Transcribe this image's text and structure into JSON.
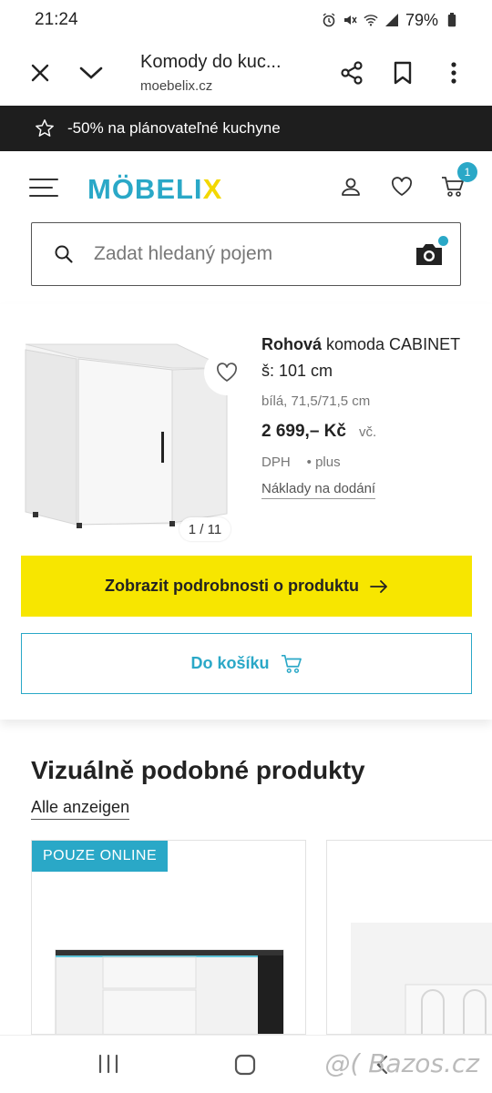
{
  "status_bar": {
    "time": "21:24",
    "battery": "79%",
    "icons": [
      "alarm-icon",
      "mute-icon",
      "wifi-icon",
      "signal-icon",
      "battery-icon"
    ]
  },
  "browser": {
    "title": "Komody do kuc...",
    "url": "moebelix.cz",
    "icons": [
      "close-icon",
      "chevron-down-icon",
      "share-icon",
      "bookmark-icon",
      "more-icon"
    ]
  },
  "promo": {
    "text": "-50% na plánovateľné kuchyne",
    "icon": "star-icon"
  },
  "header": {
    "logo_main": "MÖBELI",
    "logo_x": "X",
    "cart_count": "1",
    "search_placeholder": "Zadat hledaný pojem"
  },
  "product": {
    "name_bold": "Rohová",
    "name_rest": " komoda CABINET š: 101 cm",
    "variant": "bílá, 71,5/71,5 cm",
    "price": "2 699,– Kč",
    "vat_prefix": "vč.",
    "vat": "DPH",
    "plus": "• plus",
    "shipping": "Náklady na dodání",
    "image_counter": "1 / 11",
    "details_button": "Zobrazit podrobnosti o produktu",
    "cart_button": "Do košíku"
  },
  "similar": {
    "title": "Vizuálně podobné produkty",
    "link": "Alle anzeigen",
    "badge": "POUZE ONLINE"
  },
  "watermark": "@( Bazos.cz",
  "colors": {
    "brand_blue": "#2aa8c7",
    "brand_yellow": "#f7e600",
    "promo_bg": "#1e1e1e"
  }
}
